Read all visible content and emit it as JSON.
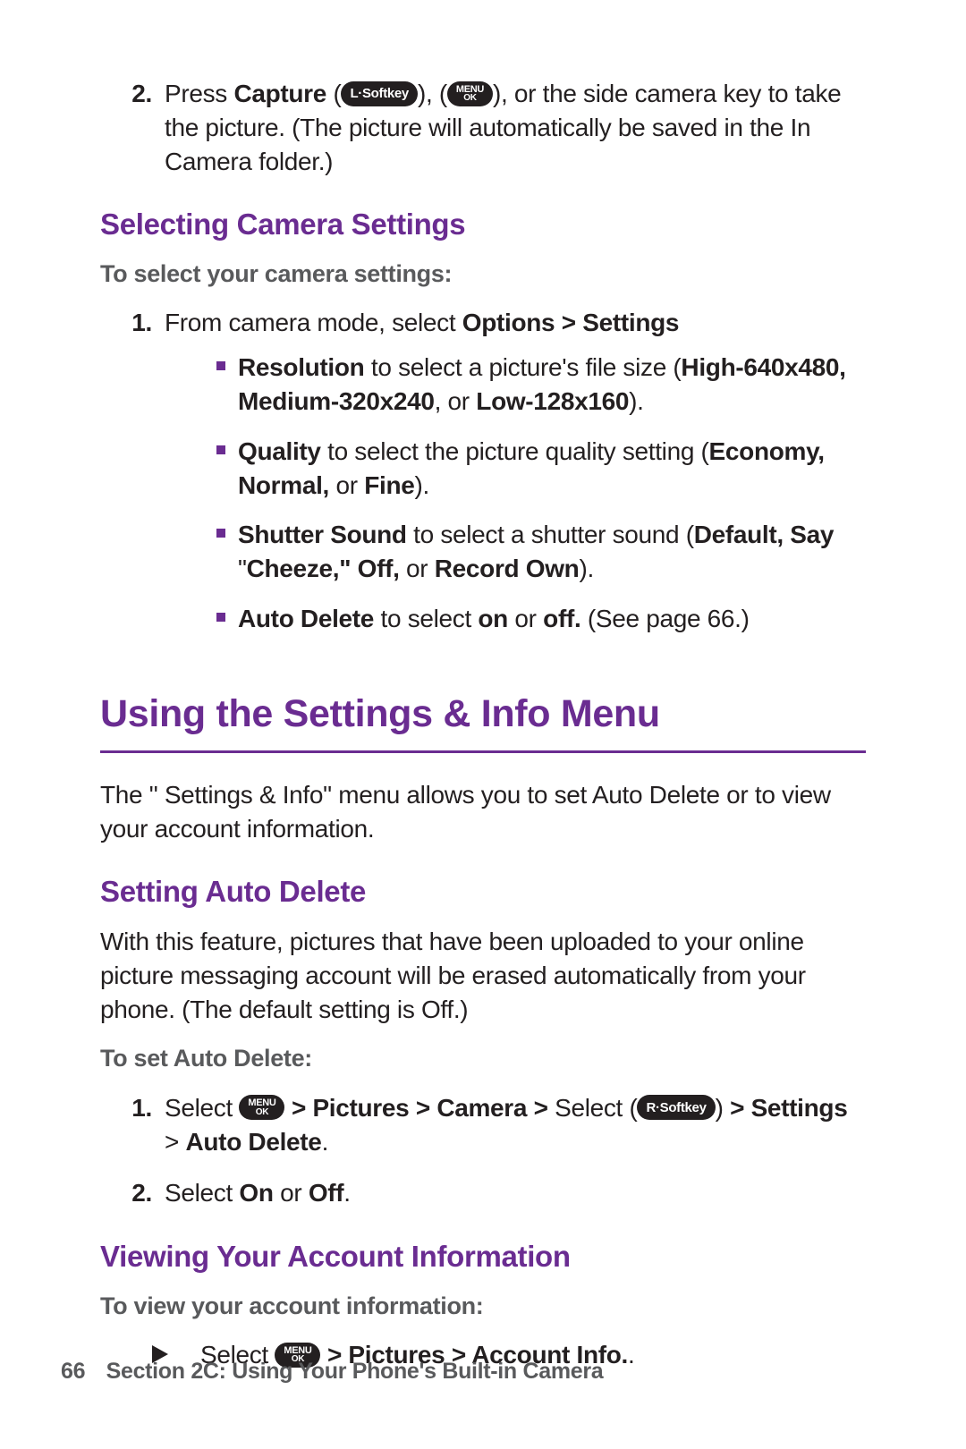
{
  "step2": {
    "num": "2.",
    "pre": "Press ",
    "capture": "Capture",
    "open1": " (",
    "close_comma": "), (",
    "close2": "), or the side camera key to take the picture. (The picture will automatically be saved in the In Camera folder.)"
  },
  "pill_lsoftkey": "L·Softkey",
  "pill_rsoftkey": "R·Softkey",
  "pill_menu_top": "MENU",
  "pill_menu_bot": "OK",
  "h2_select": "Selecting Camera Settings",
  "intro_select": "To select your camera settings:",
  "step1a": {
    "num": "1.",
    "pre": "From camera mode, select ",
    "bold": "Options > Settings"
  },
  "bullets_a": {
    "b1": {
      "lead": "Resolution",
      "rest": " to select a picture's file size (",
      "bold2": "High-640x480, Medium-320x240",
      "mid": ", or ",
      "bold3": "Low-128x160",
      "end": ")."
    },
    "b2": {
      "lead": "Quality",
      "rest": " to select the picture quality setting (",
      "bold2": "Economy, Normal,",
      "mid": " or ",
      "bold3": "Fine",
      "end": ")."
    },
    "b3": {
      "lead": "Shutter Sound",
      "rest": " to select a shutter sound (",
      "bold2": "Default, Say",
      "mid": " \"",
      "bold3": "Cheeze,\"  Off,",
      "mid2": " or ",
      "bold4": "Record Own",
      "end": ")."
    },
    "b4": {
      "lead": "Auto Delete",
      "rest": " to select ",
      "bold2": "on",
      "mid": " or ",
      "bold3": "off.",
      "end": " (See page 66.)"
    }
  },
  "h1": "Using the Settings & Info Menu",
  "para1": "The \" Settings & Info\"  menu allows you to set Auto Delete or to view your account information.",
  "h2_autodel": "Setting Auto Delete",
  "para2": "With this feature, pictures that have been uploaded to your online picture messaging account will be erased automatically from your phone. (The default setting is Off.)",
  "intro_autodel": "To set Auto Delete:",
  "ad_step1": {
    "num": "1.",
    "pre": "Select ",
    "after_menu": " ",
    "bold1": "> Pictures > Camera >",
    "mid": " Select (",
    "close": ") ",
    "bold2": "> Settings",
    "gt": " > ",
    "bold3": "Auto Delete",
    "end": "."
  },
  "ad_step2": {
    "num": "2.",
    "pre": "Select ",
    "on": "On",
    "or": " or ",
    "off": "Off",
    "end": "."
  },
  "h2_acct": "Viewing Your Account Information",
  "intro_acct": "To view your account information:",
  "acct_step": {
    "pre": "Select ",
    "bold": " > Pictures > Account Info.",
    "end": "."
  },
  "footer": {
    "page": "66",
    "text": "Section 2C: Using Your Phone's Built-in Camera"
  }
}
